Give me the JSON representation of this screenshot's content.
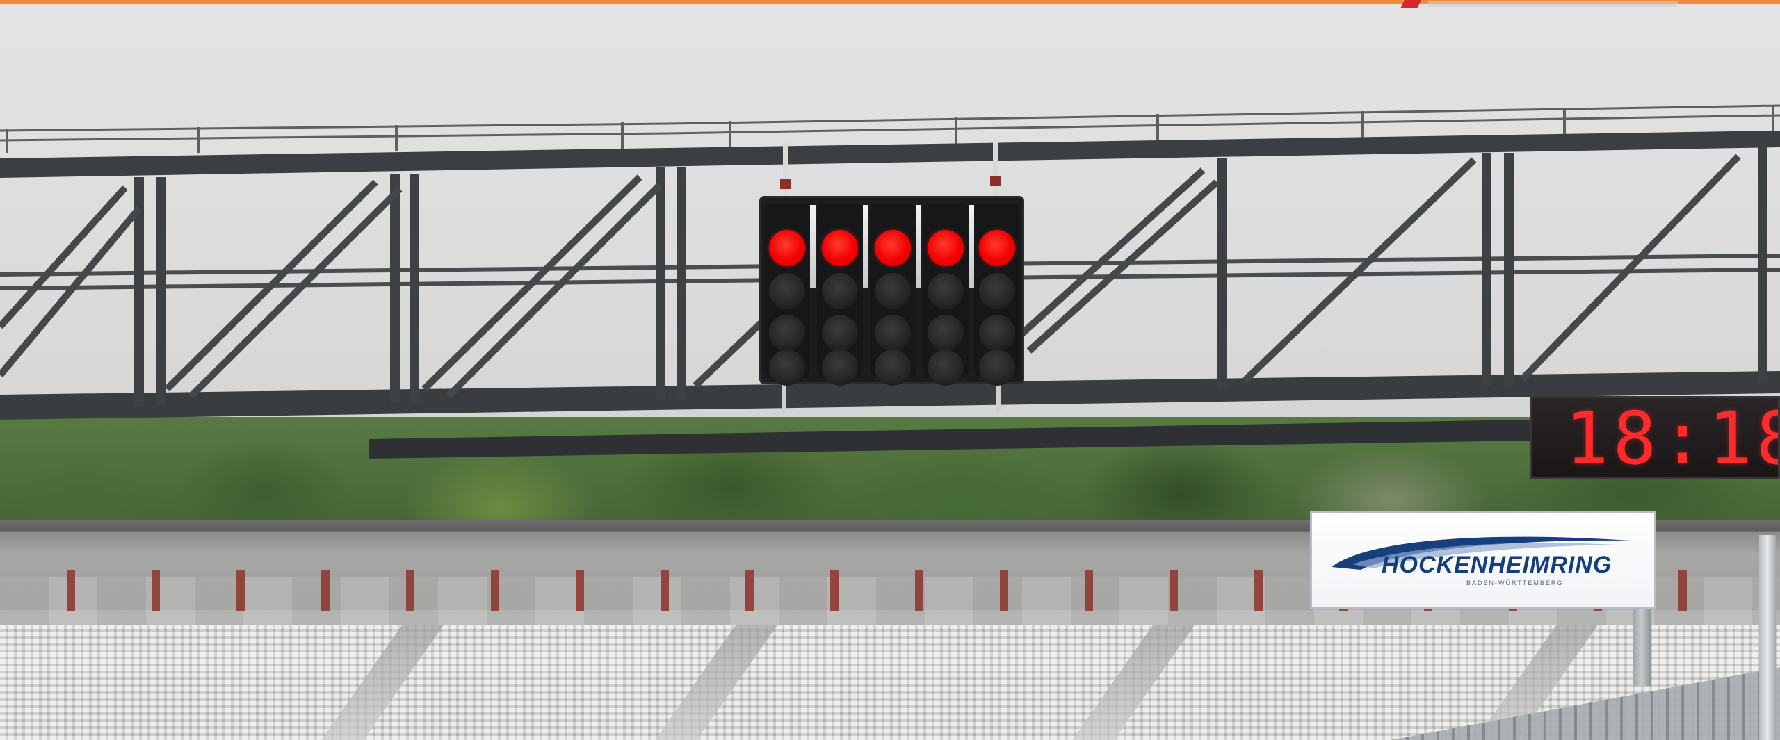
{
  "scene": {
    "description_tag": "",
    "accent_color": "#f08a3c",
    "signal": {
      "columns": 5,
      "lamps_per_column": 4,
      "lit_row": 1,
      "lit_color": "#ff0000"
    },
    "clock": {
      "display": "18:18:",
      "color": "#ff2a2a"
    },
    "sponsor": {
      "brand": "HOCKENHEIMRING",
      "tagline": "BADEN-WÜRTTEMBERG",
      "brand_color": "#143f7a"
    }
  }
}
